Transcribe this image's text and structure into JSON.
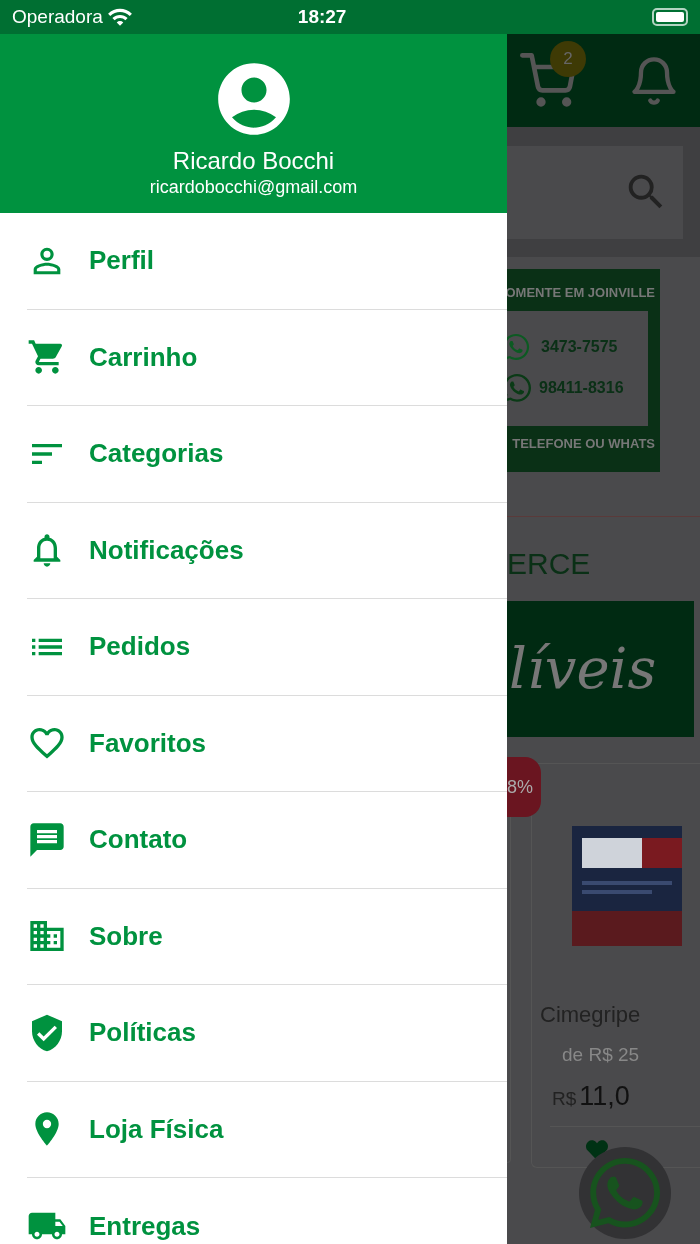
{
  "status_bar": {
    "carrier": "Operadora",
    "time": "18:27"
  },
  "drawer": {
    "user_name": "Ricardo Bocchi",
    "user_email": "ricardobocchi@gmail.com",
    "items": [
      {
        "label": "Perfil"
      },
      {
        "label": "Carrinho"
      },
      {
        "label": "Categorias"
      },
      {
        "label": "Notificações"
      },
      {
        "label": "Pedidos"
      },
      {
        "label": "Favoritos"
      },
      {
        "label": "Contato"
      },
      {
        "label": "Sobre"
      },
      {
        "label": "Políticas"
      },
      {
        "label": "Loja Física"
      },
      {
        "label": "Entregas"
      }
    ]
  },
  "background_page": {
    "cart_badge": "2",
    "banner": {
      "line_1": "OMENTE EM JOINVILLE",
      "phone": "3473-7575",
      "whatsapp": "98411-8316",
      "line_2": "TELEFONE OU WHATS"
    },
    "section_title": "ERCE",
    "promo_text": "líveis",
    "discount_badge": "8%",
    "product": {
      "name": "Cimegripe",
      "old_price": "de R$ 25",
      "currency": "R$",
      "price": "11,0"
    }
  }
}
